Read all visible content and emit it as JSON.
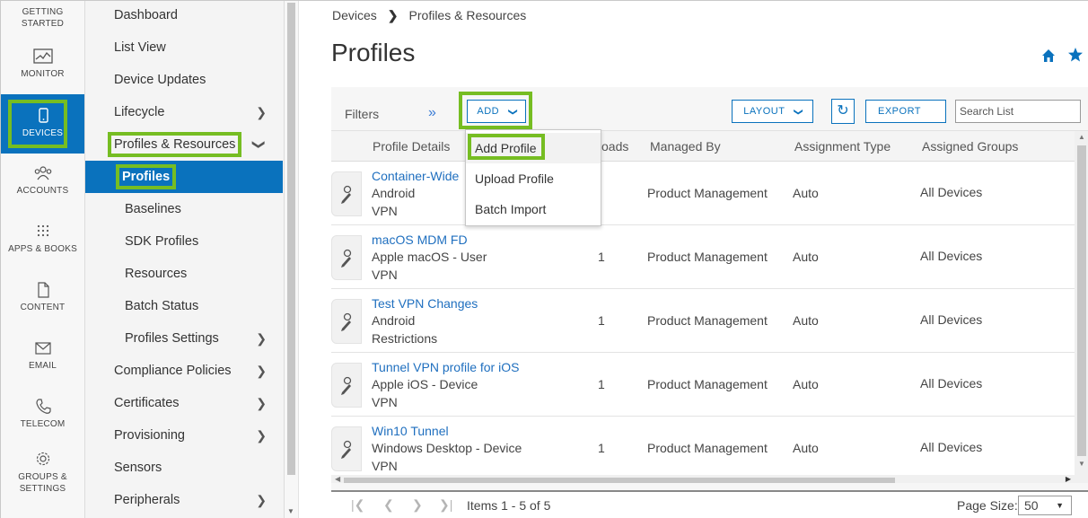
{
  "rail": {
    "items": [
      {
        "label": "GETTING STARTED",
        "icon": "getting-started-icon"
      },
      {
        "label": "MONITOR",
        "icon": "monitor-icon"
      },
      {
        "label": "DEVICES",
        "icon": "device-icon",
        "active": true
      },
      {
        "label": "ACCOUNTS",
        "icon": "accounts-icon"
      },
      {
        "label": "APPS & BOOKS",
        "icon": "apps-grid-icon"
      },
      {
        "label": "CONTENT",
        "icon": "content-icon"
      },
      {
        "label": "EMAIL",
        "icon": "email-icon"
      },
      {
        "label": "TELECOM",
        "icon": "phone-icon"
      },
      {
        "label": "GROUPS & SETTINGS",
        "icon": "gear-icon"
      }
    ]
  },
  "nav": {
    "items": [
      {
        "label": "Dashboard"
      },
      {
        "label": "List View"
      },
      {
        "label": "Device Updates"
      },
      {
        "label": "Lifecycle",
        "chevron": "right"
      },
      {
        "label": "Profiles & Resources",
        "chevron": "down"
      },
      {
        "label": "Profiles",
        "active": true
      },
      {
        "label": "Baselines"
      },
      {
        "label": "SDK Profiles"
      },
      {
        "label": "Resources"
      },
      {
        "label": "Batch Status"
      },
      {
        "label": "Profiles Settings",
        "chevron": "right"
      },
      {
        "label": "Compliance Policies",
        "chevron": "right"
      },
      {
        "label": "Certificates",
        "chevron": "right"
      },
      {
        "label": "Provisioning",
        "chevron": "right"
      },
      {
        "label": "Sensors"
      },
      {
        "label": "Peripherals",
        "chevron": "right"
      }
    ]
  },
  "breadcrumb": {
    "root": "Devices",
    "current": "Profiles & Resources"
  },
  "page": {
    "title": "Profiles"
  },
  "toolbar": {
    "filters": "Filters",
    "add": "ADD",
    "layout": "LAYOUT",
    "export": "EXPORT",
    "search_placeholder": "Search List"
  },
  "dropdown": {
    "items": [
      "Add Profile",
      "Upload Profile",
      "Batch Import"
    ]
  },
  "table": {
    "headers": [
      "Profile Details",
      "oads",
      "Managed By",
      "Assignment Type",
      "Assigned Groups"
    ],
    "rows": [
      {
        "name": "Container-Wide",
        "platform": "Android",
        "type": "VPN",
        "count": "",
        "managed_by": "Product Management",
        "assignment": "Auto",
        "groups": "All Devices"
      },
      {
        "name": "macOS MDM FD",
        "platform": "Apple macOS - User",
        "type": "VPN",
        "count": "1",
        "managed_by": "Product Management",
        "assignment": "Auto",
        "groups": "All Devices"
      },
      {
        "name": "Test VPN Changes",
        "platform": "Android",
        "type": "Restrictions",
        "count": "1",
        "managed_by": "Product Management",
        "assignment": "Auto",
        "groups": "All Devices"
      },
      {
        "name": "Tunnel VPN profile for iOS",
        "platform": "Apple iOS - Device",
        "type": "VPN",
        "count": "1",
        "managed_by": "Product Management",
        "assignment": "Auto",
        "groups": "All Devices"
      },
      {
        "name": "Win10 Tunnel",
        "platform": "Windows Desktop - Device",
        "type": "VPN",
        "count": "1",
        "managed_by": "Product Management",
        "assignment": "Auto",
        "groups": "All Devices"
      }
    ]
  },
  "pager": {
    "items_text": "Items 1 - 5 of 5",
    "page_size_label": "Page Size:",
    "page_size": "50"
  },
  "colors": {
    "accent": "#0a72bd",
    "highlight": "#76bd22",
    "link": "#1f6fbf"
  }
}
